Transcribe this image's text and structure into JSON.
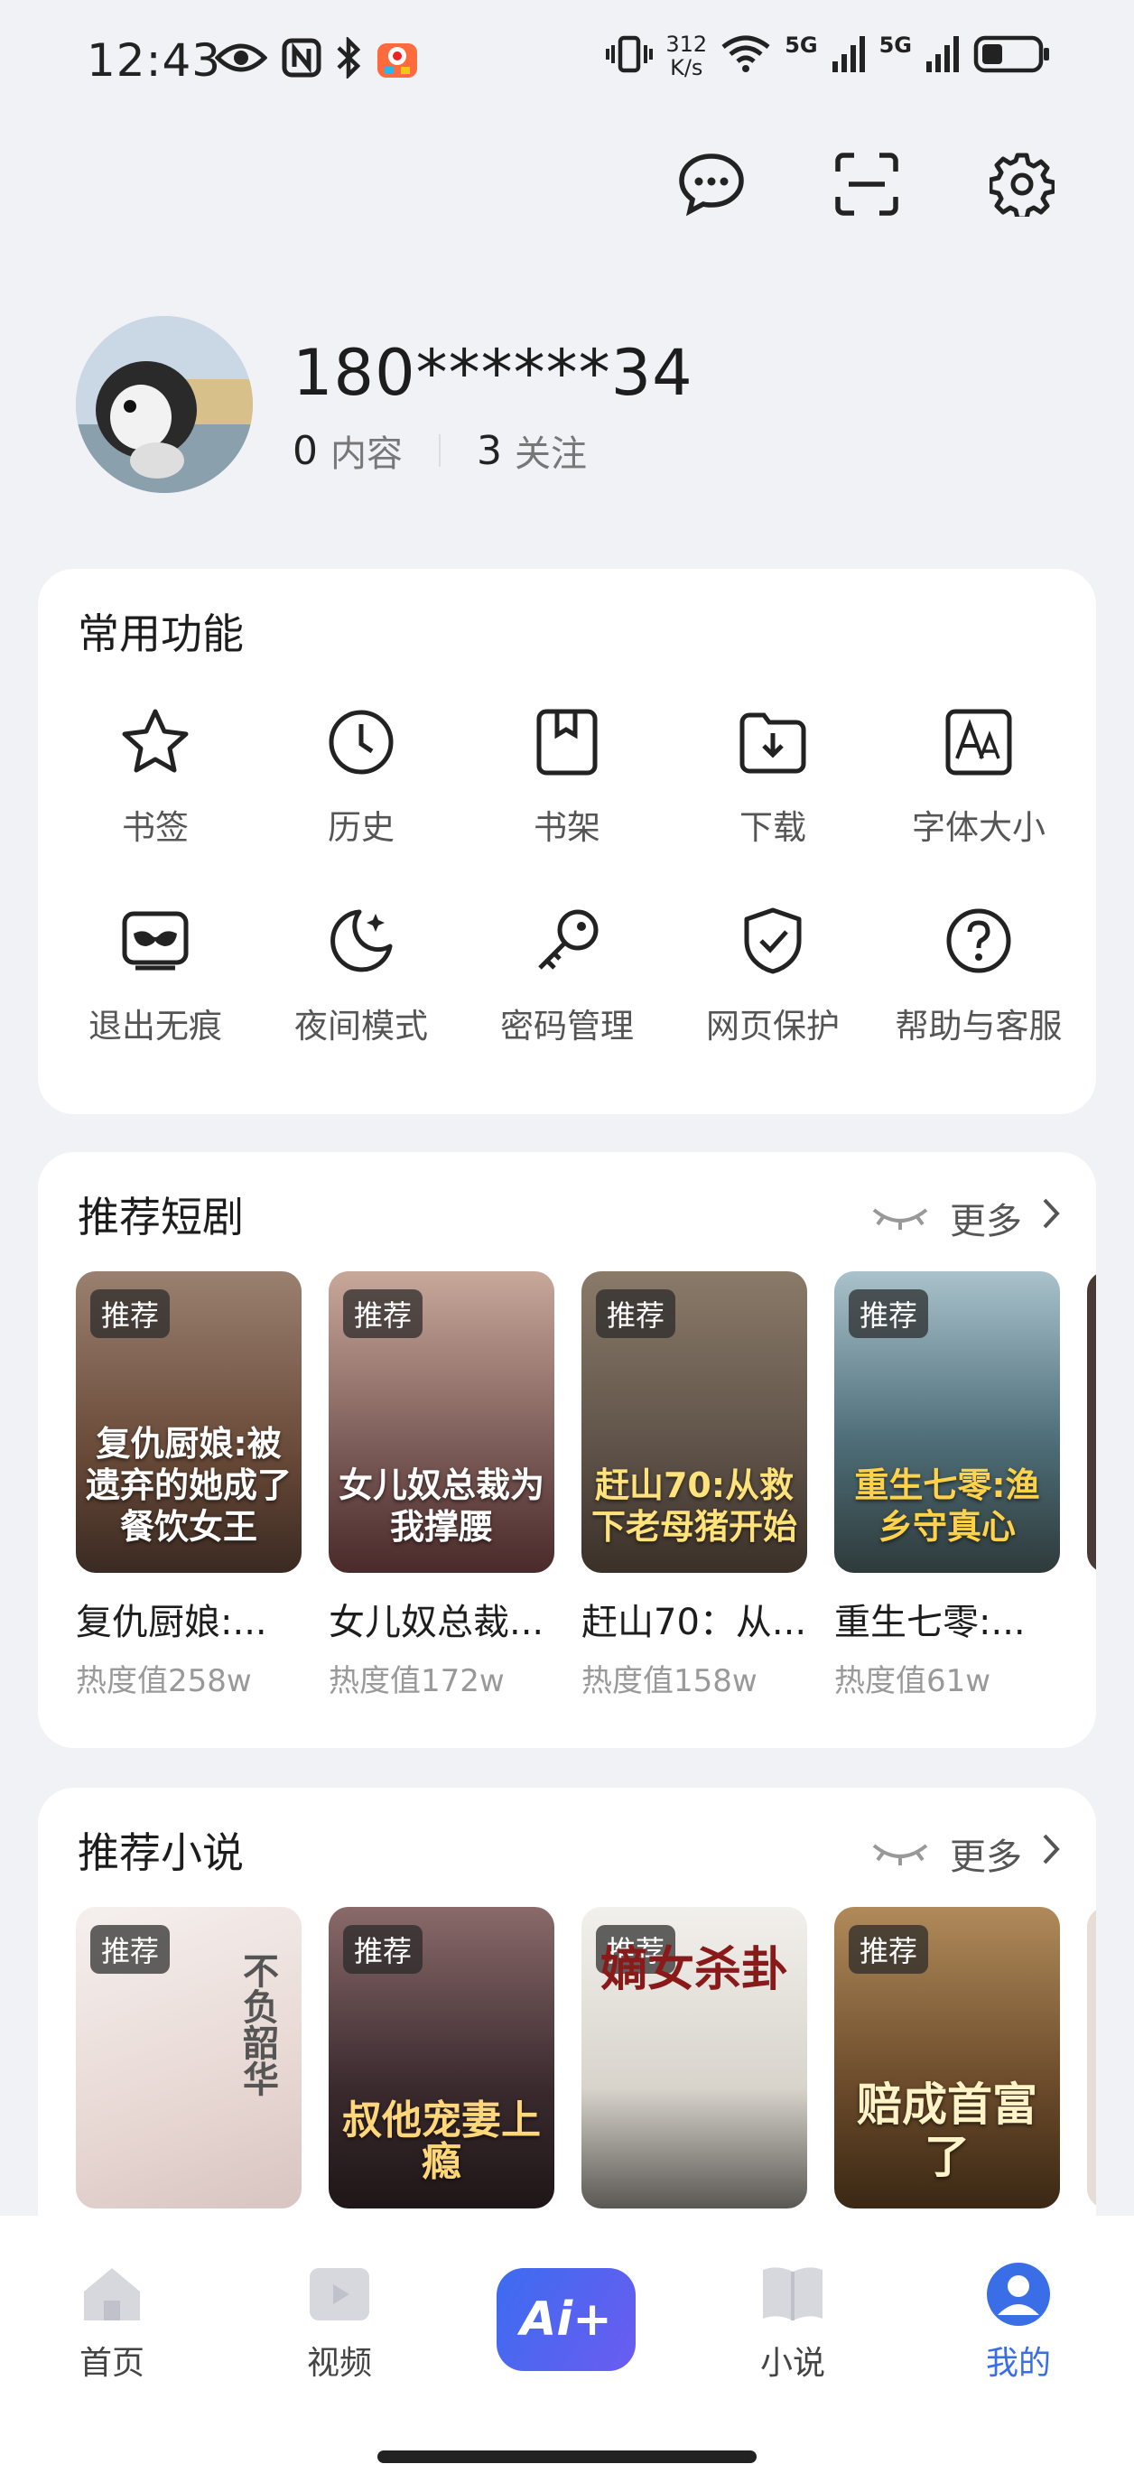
{
  "status_bar": {
    "time": "12:43",
    "speed_value": "312",
    "speed_unit": "K/s",
    "net1": "5G",
    "net2": "5G",
    "icons": [
      "eye-icon",
      "nfc-icon",
      "bluetooth-icon",
      "app-notification-icon",
      "vibrate-icon",
      "wifi-icon",
      "signal-icon",
      "battery-icon"
    ]
  },
  "top_actions": [
    "message-icon",
    "scan-icon",
    "settings-icon"
  ],
  "profile": {
    "name": "180******34",
    "content_count": "0",
    "content_label": "内容",
    "follow_count": "3",
    "follow_label": "关注"
  },
  "features": {
    "title": "常用功能",
    "items": [
      {
        "label": "书签",
        "icon": "star-icon"
      },
      {
        "label": "历史",
        "icon": "clock-icon"
      },
      {
        "label": "书架",
        "icon": "bookshelf-icon"
      },
      {
        "label": "下载",
        "icon": "download-icon"
      },
      {
        "label": "字体大小",
        "icon": "font-size-icon"
      },
      {
        "label": "退出无痕",
        "icon": "incognito-icon"
      },
      {
        "label": "夜间模式",
        "icon": "moon-icon"
      },
      {
        "label": "密码管理",
        "icon": "key-icon"
      },
      {
        "label": "网页保护",
        "icon": "shield-icon"
      },
      {
        "label": "帮助与客服",
        "icon": "help-icon"
      }
    ]
  },
  "dramas": {
    "title": "推荐短剧",
    "more": "更多",
    "items": [
      {
        "badge": "推荐",
        "cover_text": "复仇厨娘:被遗弃的她成了餐饮女王",
        "title": "复仇厨娘:...",
        "heat": "热度值258w",
        "color": "#6a4a38"
      },
      {
        "badge": "推荐",
        "cover_text": "女儿奴总裁为我撑腰",
        "title": "女儿奴总裁...",
        "heat": "热度值172w",
        "color": "#7a5a56"
      },
      {
        "badge": "推荐",
        "cover_text": "赶山70:从救下老母猪开始",
        "title": "赶山70：从...",
        "heat": "热度值158w",
        "color": "#5e5248"
      },
      {
        "badge": "推荐",
        "cover_text": "重生七零:渔乡守真心",
        "title": "重生七零:...",
        "heat": "热度值61w",
        "color": "#4f6f7a"
      }
    ]
  },
  "novels": {
    "title": "推荐小说",
    "more": "更多",
    "items": [
      {
        "badge": "推荐",
        "cover_text": "不负韶华",
        "color": "#ece6e4"
      },
      {
        "badge": "推荐",
        "cover_text": "叔他宠妻上瘾",
        "color": "#3a2a2e"
      },
      {
        "badge": "推荐",
        "cover_text": "嫡女杀卦",
        "color": "#e8e6e2"
      },
      {
        "badge": "推荐",
        "cover_text": "赔成首富了",
        "color": "#6a4a2a"
      }
    ]
  },
  "bottom_nav": {
    "home": "首页",
    "video": "视频",
    "ai": "Ai+",
    "novel": "小说",
    "mine": "我的",
    "accent": "#3a6ee6"
  }
}
